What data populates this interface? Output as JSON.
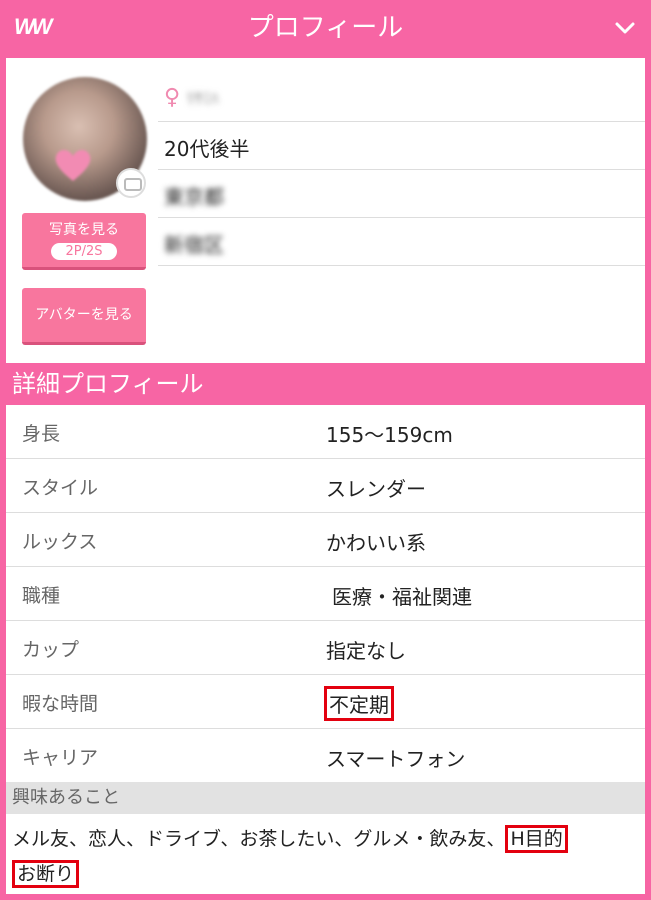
{
  "header": {
    "logo_text": "WW",
    "title": "プロフィール"
  },
  "profile": {
    "name_blurred": "ﾘｻﾐﾊ",
    "age": "20代後半",
    "region_blurred": "東京都",
    "area_blurred": "新宿区",
    "photo_button_label": "写真を見る",
    "photo_count": "2P/2S",
    "avatar_button_label": "アバターを見る"
  },
  "detail": {
    "section_title": "詳細プロフィール",
    "rows": [
      {
        "label": "身長",
        "value": "155～159cm"
      },
      {
        "label": "スタイル",
        "value": "スレンダー"
      },
      {
        "label": "ルックス",
        "value": "かわいい系"
      },
      {
        "label": "職種",
        "value": "医療・福祉関連"
      },
      {
        "label": "カップ",
        "value": "指定なし"
      },
      {
        "label": "暇な時間",
        "value": "不定期"
      },
      {
        "label": "キャリア",
        "value": "スマートフォン"
      }
    ]
  },
  "interests": {
    "section_title": "興味あること",
    "text": "メル友、恋人、ドライブ、お茶したい、グルメ・飲み友、",
    "highlight_1": "H目的",
    "highlight_2": "お断り"
  },
  "colors": {
    "brand_pink": "#f765a4",
    "button_pink": "#f8769e",
    "highlight_red": "#e3000f"
  }
}
